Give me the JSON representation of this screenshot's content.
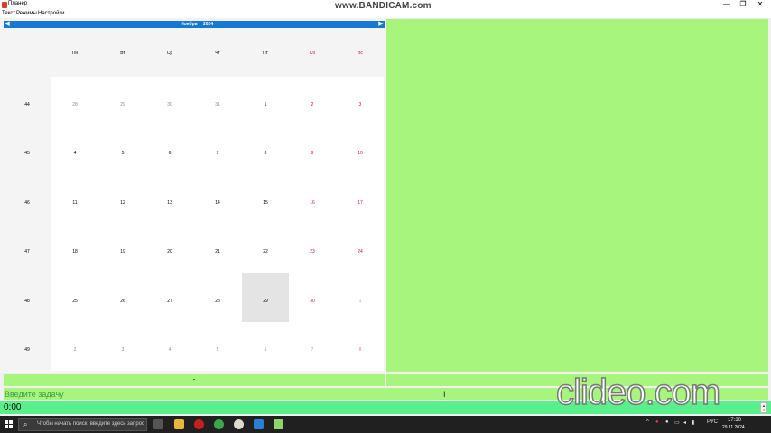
{
  "window": {
    "title": "Планер",
    "minimize": "—",
    "maximize": "❐",
    "close": "✕"
  },
  "watermark_top": "www.BANDICAM.com",
  "watermark_bottom": "clideo.com",
  "menu": [
    "Текст",
    "Режимы",
    "Настройки"
  ],
  "calendar": {
    "prev_icon": "arrow-left-icon",
    "next_icon": "arrow-right-icon",
    "prev_glyph": "◀",
    "next_glyph": "▶",
    "month": "Ноябрь",
    "year": "2024",
    "weekdays": [
      "Пн",
      "Вт",
      "Ср",
      "Чт",
      "Пт",
      "Сб",
      "Вс"
    ],
    "weeks": [
      {
        "num": "44",
        "days": [
          "28",
          "29",
          "30",
          "31",
          "1",
          "2",
          "3"
        ]
      },
      {
        "num": "45",
        "days": [
          "4",
          "5",
          "6",
          "7",
          "8",
          "9",
          "10"
        ]
      },
      {
        "num": "46",
        "days": [
          "11",
          "12",
          "13",
          "14",
          "15",
          "16",
          "17"
        ]
      },
      {
        "num": "47",
        "days": [
          "18",
          "19",
          "20",
          "21",
          "22",
          "23",
          "24"
        ]
      },
      {
        "num": "48",
        "days": [
          "25",
          "26",
          "27",
          "28",
          "29",
          "30",
          "1"
        ]
      },
      {
        "num": "49",
        "days": [
          "2",
          "3",
          "4",
          "5",
          "6",
          "7",
          "8"
        ]
      }
    ],
    "selected_day": "29",
    "weekend_color": "#c8102e",
    "header_color": "#1479d4"
  },
  "buttons": {
    "minus": "-",
    "plus": "+"
  },
  "task_input": {
    "placeholder": "Введите задачу",
    "value": ""
  },
  "time": {
    "value": "0:00",
    "spin_up": "▲",
    "spin_down": "▼"
  },
  "colors": {
    "panel": "#a8f57d",
    "time_row": "#57f08a"
  },
  "taskbar": {
    "search_placeholder": "Чтобы начать поиск, введите здесь запрос",
    "language": "РУС",
    "time": "17:30",
    "date": "29.11.2024"
  }
}
